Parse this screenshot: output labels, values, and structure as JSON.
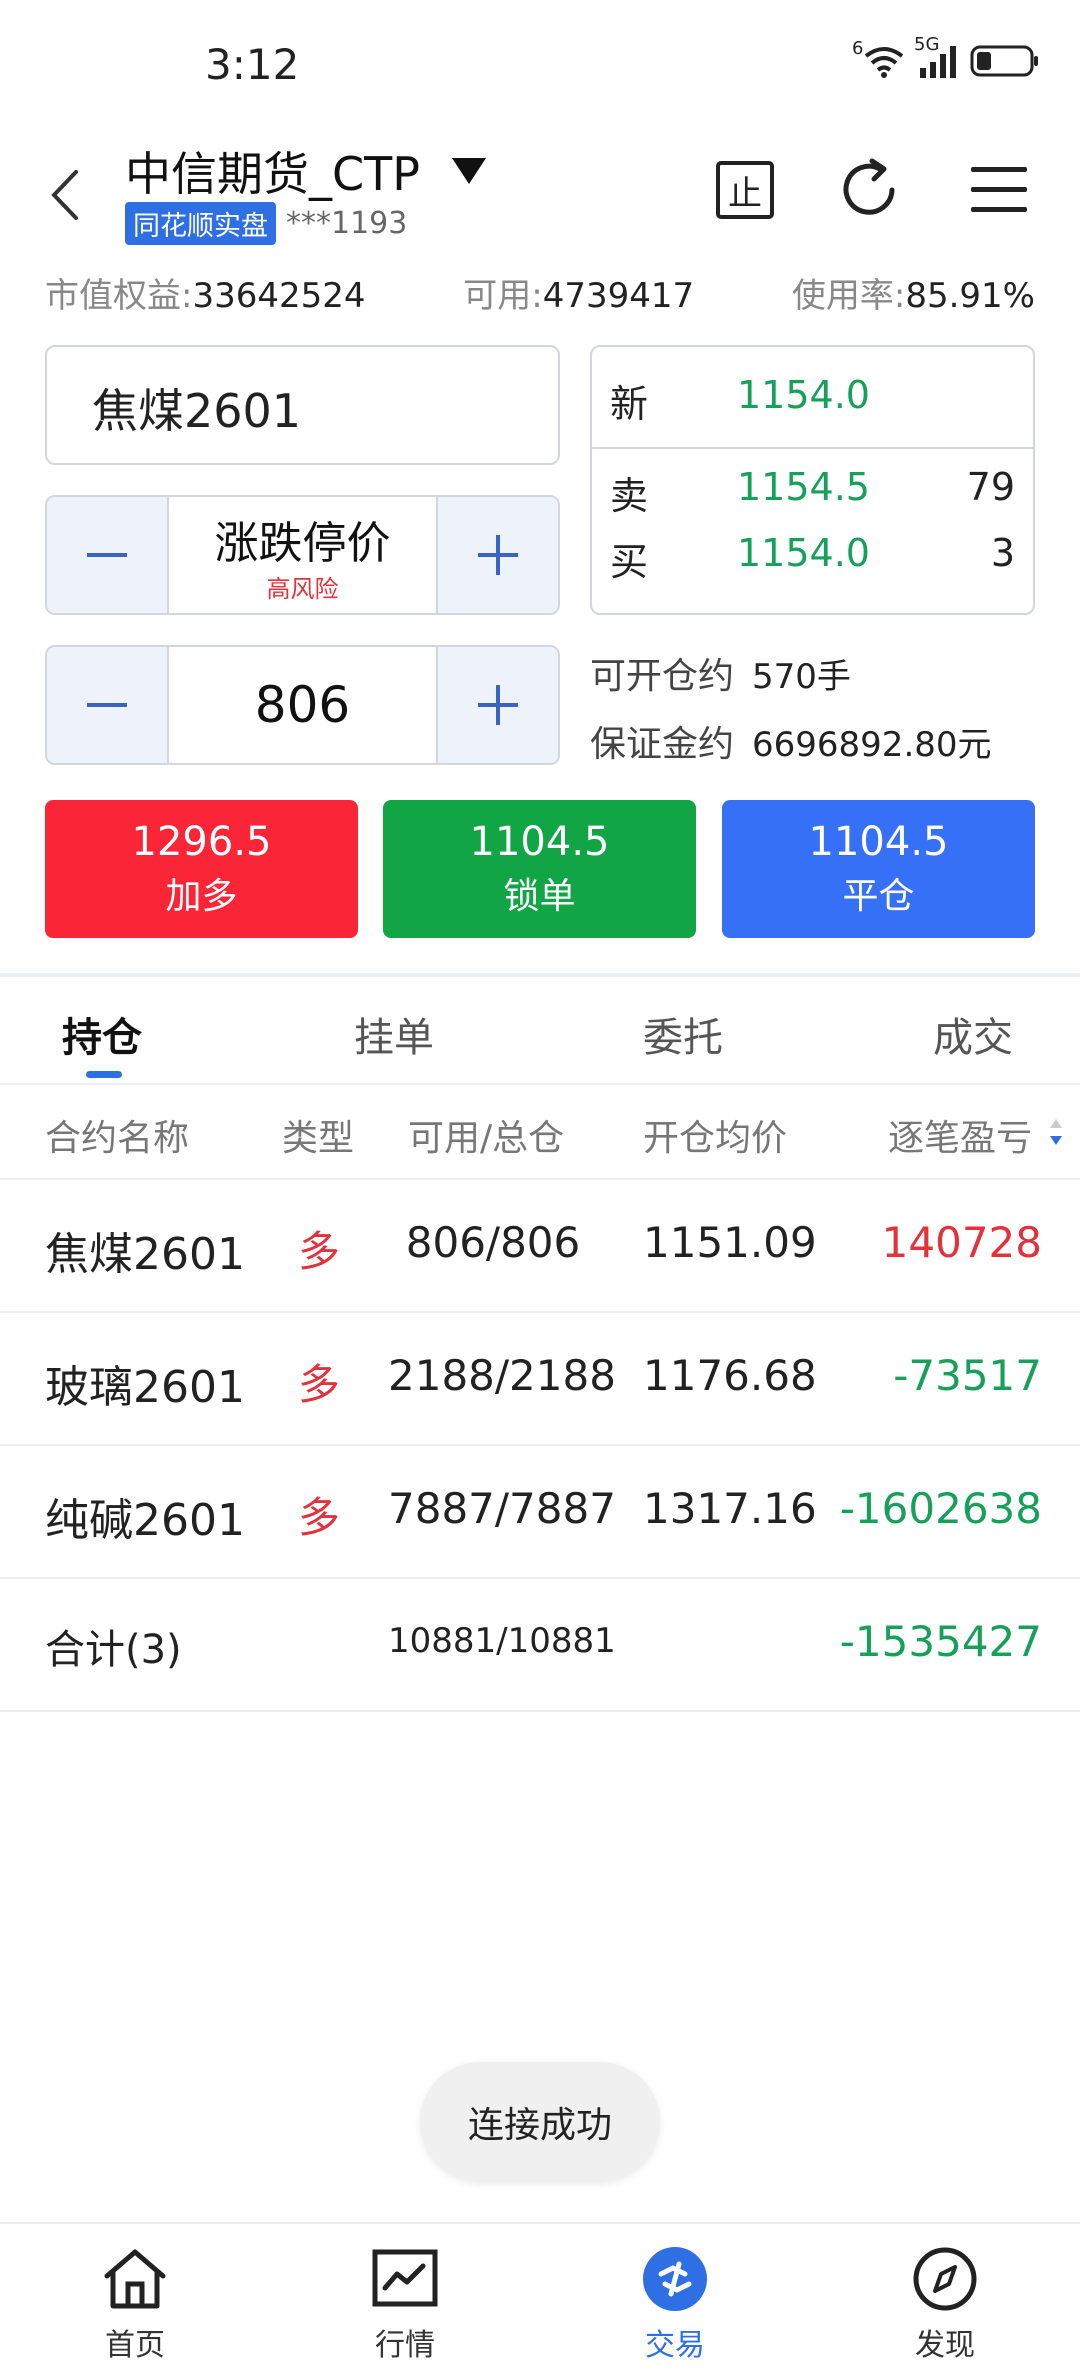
{
  "status": {
    "time": "3:12",
    "wifi_label": "6",
    "network": "5G"
  },
  "header": {
    "title": "中信期货_CTP",
    "badge": "同花顺实盘",
    "account_no": "***1193",
    "stop_icon_label": "止"
  },
  "summary": {
    "equity_label": "市值权益:",
    "equity_value": "33642524",
    "available_label": "可用:",
    "available_value": "4739417",
    "usage_label": "使用率:",
    "usage_value": "85.91%"
  },
  "order": {
    "contract": "焦煤2601",
    "price_mode": "涨跌停价",
    "price_risk": "高风险",
    "quantity": "806",
    "open_label": "可开仓约",
    "open_value": "570手",
    "margin_label": "保证金约",
    "margin_value": "6696892.80元"
  },
  "quote": {
    "last_label": "新",
    "last_price": "1154.0",
    "ask_label": "卖",
    "ask_price": "1154.5",
    "ask_vol": "79",
    "bid_label": "买",
    "bid_price": "1154.0",
    "bid_vol": "3"
  },
  "actions": [
    {
      "price": "1296.5",
      "label": "加多",
      "color": "#fa2537"
    },
    {
      "price": "1104.5",
      "label": "锁单",
      "color": "#11a546"
    },
    {
      "price": "1104.5",
      "label": "平仓",
      "color": "#3670f6"
    }
  ],
  "tabs": [
    "持仓",
    "挂单",
    "委托",
    "成交"
  ],
  "table": {
    "headers": [
      "合约名称",
      "类型",
      "可用/总仓",
      "开仓均价",
      "逐笔盈亏"
    ],
    "rows": [
      {
        "name": "焦煤2601",
        "type": "多",
        "position": "806/806",
        "avg": "1151.09",
        "pnl": "140728"
      },
      {
        "name": "玻璃2601",
        "type": "多",
        "position": "2188/2188",
        "avg": "1176.68",
        "pnl": "-73517"
      },
      {
        "name": "纯碱2601",
        "type": "多",
        "position": "7887/7887",
        "avg": "1317.16",
        "pnl": "-1602638"
      }
    ],
    "total": {
      "name": "合计(3)",
      "position": "10881/10881",
      "pnl": "-1535427"
    }
  },
  "toast": "连接成功",
  "nav": [
    {
      "label": "首页",
      "icon": "home-icon"
    },
    {
      "label": "行情",
      "icon": "chart-icon"
    },
    {
      "label": "交易",
      "icon": "trade-icon"
    },
    {
      "label": "发现",
      "icon": "compass-icon"
    }
  ],
  "colors": {
    "accent": "#2f6fe4",
    "up": "#e2323c",
    "down": "#16a05a"
  }
}
